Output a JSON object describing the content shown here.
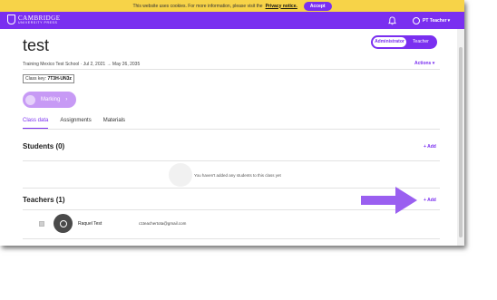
{
  "cookie_banner": {
    "text": "This website uses cookies. For more information, please visit the",
    "link": "Privacy notice.",
    "accept_label": "Accept"
  },
  "header": {
    "logo_name": "CAMBRIDGE",
    "logo_sub": "UNIVERSITY PRESS",
    "user_label": "PT Teacher",
    "user_chevron": "▾"
  },
  "class": {
    "title": "test",
    "meta": "Training Mexico Test School · Jul 2, 2021 → May 26, 2035",
    "actions_label": "Actions",
    "actions_chevron": "▾",
    "class_key_label": "Class key:",
    "class_key_value": "7T3H-UN3z",
    "marking_label": "Marking",
    "marking_chevron": "›"
  },
  "role_toggle": {
    "options": [
      "Administrator",
      "Teacher"
    ]
  },
  "tabs": [
    "Class data",
    "Assignments",
    "Materials"
  ],
  "students": {
    "title": "Students (0)",
    "add_label": "+ Add",
    "empty_text": "You haven't added any students to this class yet"
  },
  "teachers": {
    "title": "Teachers (1)",
    "add_label": "+ Add",
    "rows": [
      {
        "name": "Raquel Test",
        "email": "c1teachertota@gmail.com"
      }
    ]
  },
  "colors": {
    "brand_purple": "#7a2ff0",
    "banner_yellow": "#f7d348",
    "arrow_purple": "#9a5ff0"
  },
  "icons": [
    "cambridge-crest-icon",
    "bell-icon",
    "user-avatar-icon",
    "chevron-down-icon",
    "chevron-right-icon",
    "checkbox-icon",
    "profile-icon",
    "annotation-arrow"
  ]
}
